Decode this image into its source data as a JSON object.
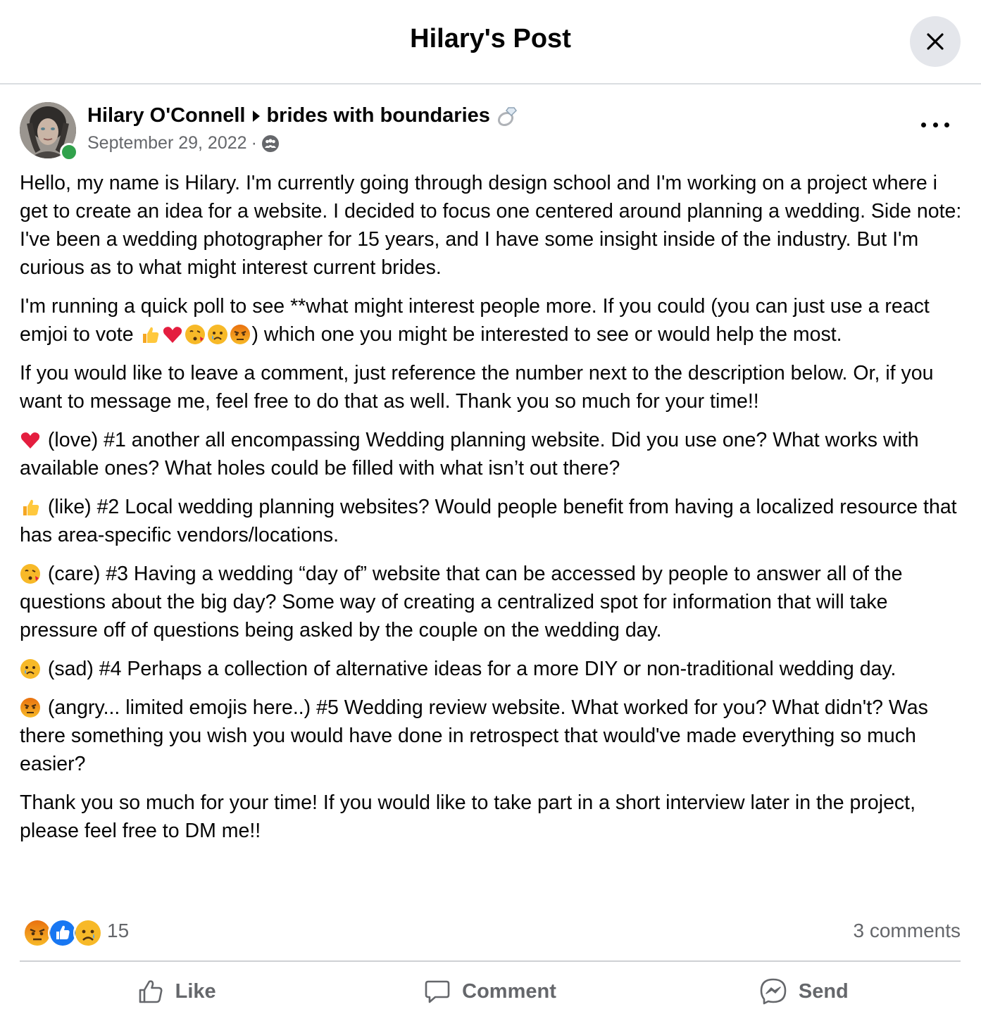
{
  "dialog": {
    "title": "Hilary's Post"
  },
  "post": {
    "author": "Hilary O'Connell",
    "group": "brides with boundaries",
    "date": "September 29, 2022",
    "separator": "·",
    "paragraphs": {
      "p1": "Hello, my name is Hilary. I'm currently going through design school and I'm working on a project where i get to create an idea for a website. I decided to focus one centered around planning a wedding. Side note: I've been a wedding photographer for 15 years, and I have some insight inside of the industry. But I'm curious as to what might interest current brides.",
      "p2_before": "I'm running a quick poll to see **what might interest people more. If you could (you can just use a react emjoi to vote ",
      "p2_after": ") which one you might be interested to see or would help the most.",
      "p3": "If you would like to leave a comment, just reference the number next to the description below. Or, if you want to message me, feel free to do that as well. Thank you so much for your time!!",
      "p4": " (love) #1 another all encompassing Wedding planning website. Did you use one? What works with available ones? What holes could be filled with what isn’t out there?",
      "p5": " (like) #2 Local wedding planning websites? Would people benefit from having a localized resource that has area-specific vendors/locations.",
      "p6": " (care) #3 Having a wedding “day of” website that can be accessed by people to answer all of the questions about the big day? Some way of creating a centralized spot for information that will take pressure off of questions being asked by the couple on the wedding day.",
      "p7": " (sad) #4 Perhaps a collection of alternative ideas for a more DIY or non-traditional wedding day.",
      "p8": " (angry... limited emojis here..) #5 Wedding review website. What worked for you? What didn't? Was there something you wish you would have done in retrospect that would've made everything so much easier?",
      "p9": "Thank you so much for your time! If you would like to take part in a short interview later in the project, please feel free to DM me!!"
    }
  },
  "stats": {
    "reaction_count": "15",
    "comments": "3 comments"
  },
  "actions": {
    "like": "Like",
    "comment": "Comment",
    "send": "Send"
  },
  "icons": {
    "close": "close-icon",
    "more": "more-options-icon",
    "privacy": "group-privacy-icon",
    "ring": "ring-icon",
    "like": "thumbs-up-icon",
    "comment": "speech-bubble-icon",
    "send": "messenger-icon"
  },
  "colors": {
    "accent_blue": "#1877f2",
    "muted_text": "#65676b",
    "online_green": "#31a24c",
    "love_red": "#e41e3f",
    "emoji_yellow": "#f7b928"
  }
}
